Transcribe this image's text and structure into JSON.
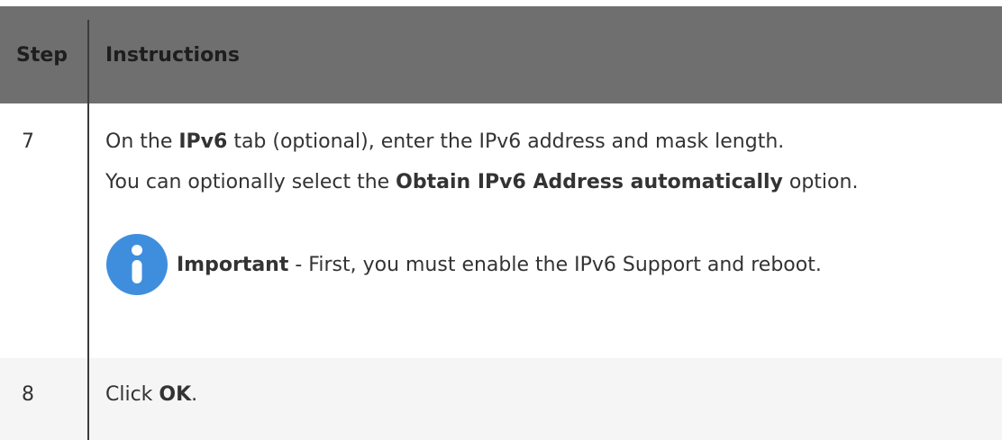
{
  "table": {
    "headers": {
      "step": "Step",
      "instructions": "Instructions"
    },
    "rows": [
      {
        "step": "7",
        "line1": {
          "t1": "On the ",
          "b1": "IPv6",
          "t2": " tab (optional), enter the IPv6 address and mask length."
        },
        "line2": {
          "t1": "You can optionally select the ",
          "b1": "Obtain IPv6 Address automatically",
          "t2": " option."
        },
        "note": {
          "icon": "info-icon",
          "bold": "Important",
          "text": " - First, you must enable the IPv6 Support and reboot."
        }
      },
      {
        "step": "8",
        "line1": {
          "t1": "Click ",
          "b1": "OK",
          "t2": "."
        }
      }
    ]
  },
  "colors": {
    "header_bg": "#6f6f6f",
    "info_icon": "#3f8ede",
    "alt_row_bg": "#f5f5f5"
  }
}
